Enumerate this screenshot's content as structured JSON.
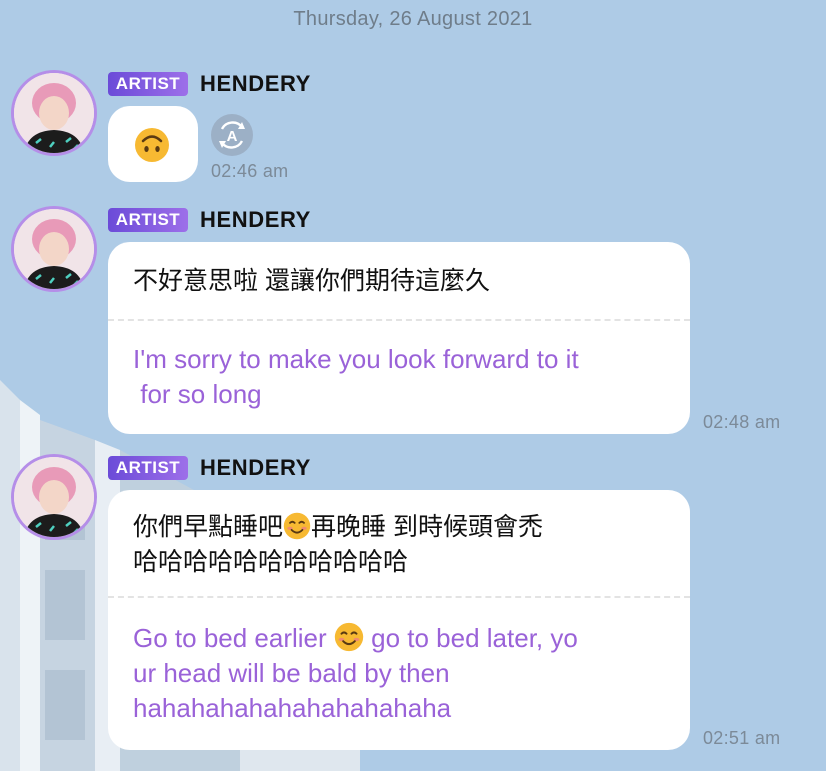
{
  "header": {
    "date": "Thursday, 26 August 2021"
  },
  "messages": [
    {
      "badge": "ARTIST",
      "sender": "HENDERY",
      "emoji": "upside-down-face",
      "time": "02:46 am"
    },
    {
      "badge": "ARTIST",
      "sender": "HENDERY",
      "original": "不好意思啦 還讓你們期待這麼久",
      "translation_line1": "I'm sorry to make you look forward to it",
      "translation_line2": " for so long",
      "time": "02:48 am"
    },
    {
      "badge": "ARTIST",
      "sender": "HENDERY",
      "original_line1a": "你們早點睡吧",
      "original_line1b": "再晚睡 到時候頭會禿",
      "original_line2": "哈哈哈哈哈哈哈哈哈哈哈",
      "translation_line1a": "Go to bed earlier ",
      "translation_line1b": " go to bed later, yo",
      "translation_line2": "ur head will be bald by then",
      "translation_line3": "hahahahahahahahahahaha",
      "time": "02:51 am"
    }
  ],
  "icons": {
    "translate": "translate-icon",
    "emoji": "smiling-face-icon"
  },
  "colors": {
    "background": "#aecbe6",
    "badge": "#7c58e0",
    "avatar_ring": "#b58ee8",
    "translation_text": "#9a62d8"
  }
}
